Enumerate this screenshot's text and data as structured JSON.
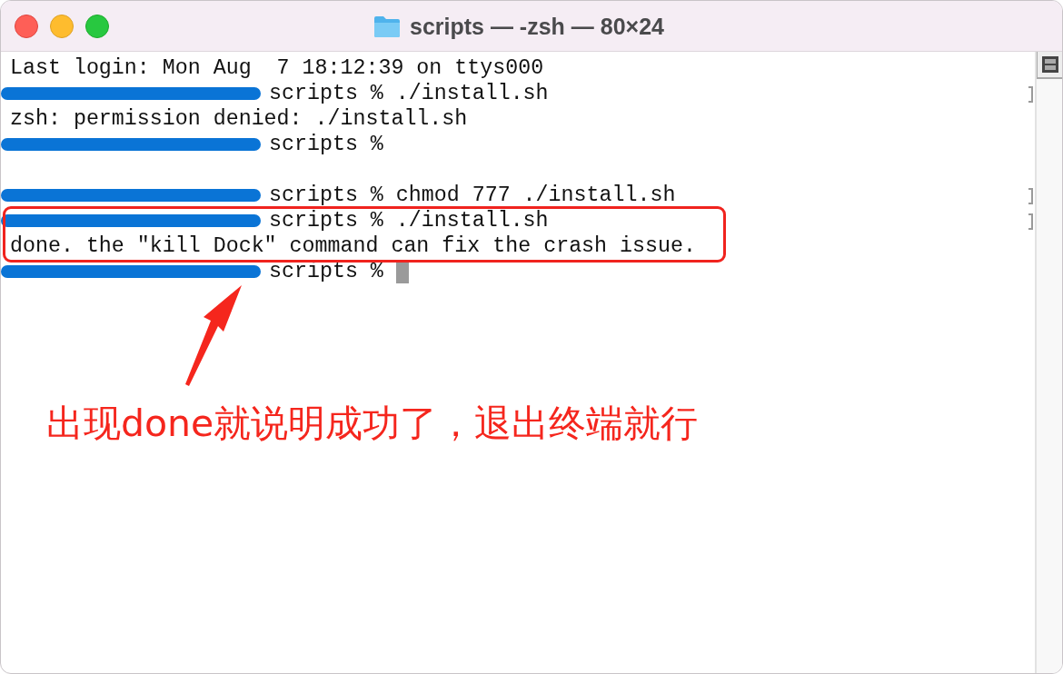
{
  "window": {
    "title": "scripts — -zsh — 80×24"
  },
  "terminal": {
    "lines": [
      {
        "kind": "output",
        "text": "Last login: Mon Aug  7 18:12:39 on ttys000"
      },
      {
        "kind": "prompt",
        "text": "scripts % ./install.sh",
        "marked": true
      },
      {
        "kind": "output",
        "text": "zsh: permission denied: ./install.sh"
      },
      {
        "kind": "prompt",
        "text": "scripts %"
      },
      {
        "kind": "blank"
      },
      {
        "kind": "prompt",
        "text": "scripts % chmod 777 ./install.sh",
        "marked": true
      },
      {
        "kind": "prompt",
        "text": "scripts % ./install.sh",
        "marked": true,
        "highlighted": true
      },
      {
        "kind": "output",
        "text": "done. the \"kill Dock\" command can fix the crash issue.",
        "highlighted": true
      },
      {
        "kind": "prompt",
        "text": "scripts %",
        "cursor": true
      }
    ]
  },
  "annotation": {
    "text": "出现done就说明成功了，退出终端就行"
  }
}
